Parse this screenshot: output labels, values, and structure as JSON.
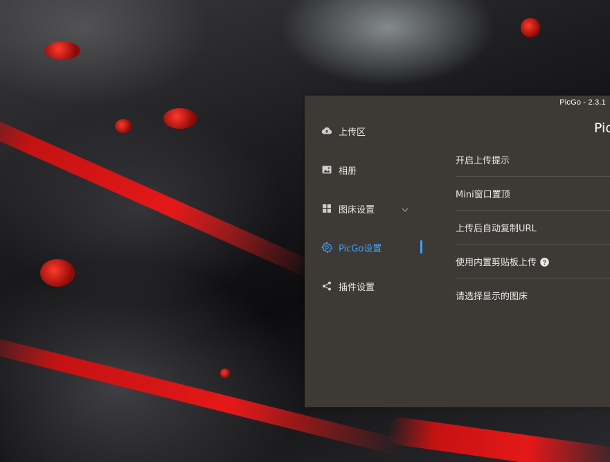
{
  "window": {
    "version": "PicGo - 2.3.1",
    "page_title": "Pic"
  },
  "sidebar": {
    "items": [
      {
        "label": "上传区",
        "icon": "cloud-upload-icon",
        "active": false
      },
      {
        "label": "相册",
        "icon": "image-icon",
        "active": false
      },
      {
        "label": "图床设置",
        "icon": "grid-icon",
        "active": false,
        "expandable": true
      },
      {
        "label": "PicGo设置",
        "icon": "gear-icon",
        "active": true
      },
      {
        "label": "插件设置",
        "icon": "share-icon",
        "active": false
      }
    ]
  },
  "settings": {
    "rows": [
      {
        "label": "开启上传提示"
      },
      {
        "label": "Mini窗口置顶"
      },
      {
        "label": "上传后自动复制URL"
      },
      {
        "label": "使用内置剪贴板上传",
        "help": true
      },
      {
        "label": "请选择显示的图床"
      }
    ]
  },
  "colors": {
    "window_bg": "#3d3a35",
    "accent": "#409eff",
    "text": "#e6e6e6",
    "divider": "#5a5650"
  }
}
